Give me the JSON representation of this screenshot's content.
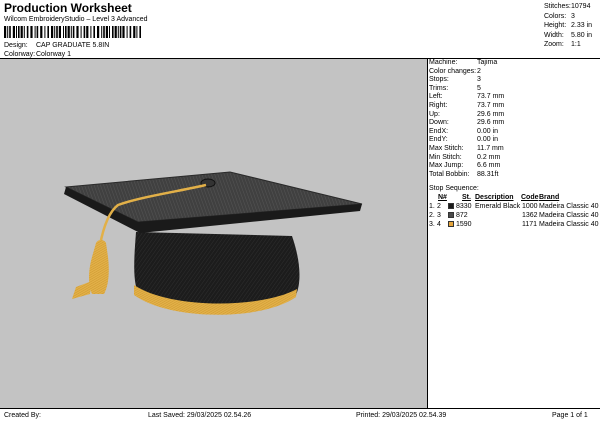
{
  "header": {
    "title": "Production Worksheet",
    "subtitle": "Wilcom EmbroideryStudio – Level 3 Advanced",
    "design_label": "Design:",
    "design_value": "CAP GRADUATE 5.8IN",
    "colorway_label": "Colorway:",
    "colorway_value": "Colorway 1"
  },
  "stats": [
    {
      "label": "Stitches:",
      "value": "10794"
    },
    {
      "label": "Colors:",
      "value": "3"
    },
    {
      "label": "Height:",
      "value": "2.33 in"
    },
    {
      "label": "Width:",
      "value": "5.80 in"
    },
    {
      "label": "Zoom:",
      "value": "1:1"
    }
  ],
  "properties": [
    {
      "label": "Machine:",
      "value": "Tajima"
    },
    {
      "label": "Color changes:",
      "value": "2"
    },
    {
      "label": "Stops:",
      "value": "3"
    },
    {
      "label": "Trims:",
      "value": "5"
    },
    {
      "label": "Left:",
      "value": "73.7 mm"
    },
    {
      "label": "Right:",
      "value": "73.7 mm"
    },
    {
      "label": "Up:",
      "value": "29.6 mm"
    },
    {
      "label": "Down:",
      "value": "29.6 mm"
    },
    {
      "label": "EndX:",
      "value": "0.00 in"
    },
    {
      "label": "EndY:",
      "value": "0.00 in"
    },
    {
      "label": "Max Stitch:",
      "value": "11.7 mm"
    },
    {
      "label": "Min Stitch:",
      "value": "0.2 mm"
    },
    {
      "label": "Max Jump:",
      "value": "6.6 mm"
    },
    {
      "label": "Total Bobbin:",
      "value": "88.31ft"
    }
  ],
  "stop_sequence": {
    "title": "Stop Sequence:",
    "columns": [
      "N#",
      "St.",
      "Description",
      "Code",
      "Brand"
    ],
    "rows": [
      {
        "stop": "1.",
        "n": "2",
        "color": "#1a1a1a",
        "code_no": "8330",
        "description": "Emerald Black",
        "st": "1000",
        "brand": "Madeira Classic 40"
      },
      {
        "stop": "2.",
        "n": "3",
        "color": "#4a4a4a",
        "code_no": "872",
        "description": "",
        "st": "1362",
        "brand": "Madeira Classic 40"
      },
      {
        "stop": "3.",
        "n": "4",
        "color": "#e6a53c",
        "code_no": "1590",
        "description": "",
        "st": "1171",
        "brand": "Madeira Classic 40"
      }
    ]
  },
  "footer": {
    "created_by": "Created By:",
    "last_saved": "Last Saved: 29/03/2025 02.54.26",
    "printed": "Printed: 29/03/2025 02.54.39",
    "page": "Page 1 of 1"
  }
}
